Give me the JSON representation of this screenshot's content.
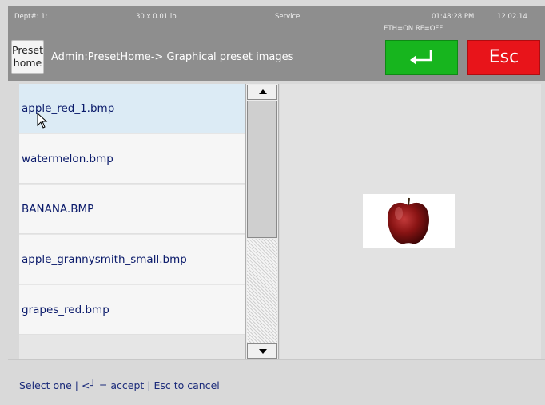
{
  "status": {
    "dept": "Dept#: 1:",
    "weight": "30 x 0.01 lb",
    "mode": "Service",
    "time": "01:48:28 PM",
    "date": "12.02.14",
    "network": "ETH=ON RF=OFF"
  },
  "header": {
    "preset_home_line1": "Preset",
    "preset_home_line2": "home",
    "breadcrumb": "Admin:PresetHome-> Graphical preset images",
    "accept_icon": "enter-arrow-icon",
    "esc_label": "Esc"
  },
  "list": {
    "items": [
      {
        "label": "apple_red_1.bmp",
        "selected": true
      },
      {
        "label": "watermelon.bmp",
        "selected": false
      },
      {
        "label": "BANANA.BMP",
        "selected": false
      },
      {
        "label": "apple_grannysmith_small.bmp",
        "selected": false
      },
      {
        "label": "grapes_red.bmp",
        "selected": false
      }
    ]
  },
  "preview": {
    "icon": "red-apple-image"
  },
  "hint": "Select one | <┘ = accept | Esc to cancel",
  "colors": {
    "accept": "#17b51e",
    "esc": "#e8141a",
    "bar": "#8e8e8e",
    "selected_row": "#dcebf5"
  }
}
